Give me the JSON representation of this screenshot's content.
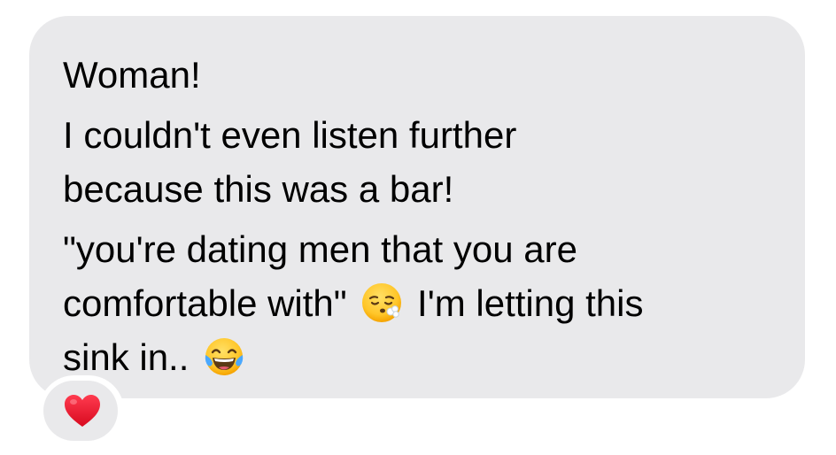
{
  "message": {
    "lines": [
      "Woman!",
      "I couldn't even listen further",
      "because this was a bar!",
      "\"you're dating men that you are",
      "comfortable with\"",
      "I'm letting this",
      "sink in.."
    ],
    "emojis": [
      "face-exhaling-icon",
      "tears-of-joy-icon"
    ]
  },
  "reaction": {
    "icon": "red-heart-icon",
    "color": "#f0142b"
  },
  "colors": {
    "bubble": "#e9e9eb",
    "text": "#000000",
    "background": "#ffffff"
  }
}
